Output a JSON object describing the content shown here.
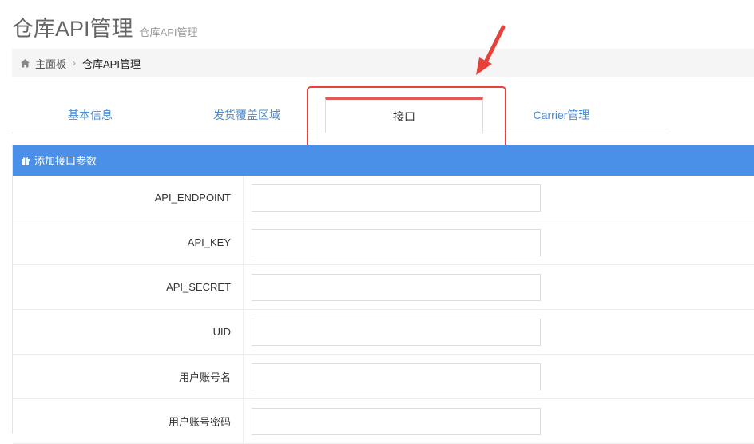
{
  "header": {
    "title": "仓库API管理",
    "subtitle": "仓库API管理"
  },
  "breadcrumb": {
    "home_icon": "home-icon",
    "items": [
      "主面板",
      "仓库API管理"
    ]
  },
  "tabs": [
    {
      "label": "基本信息",
      "active": false
    },
    {
      "label": "发货覆盖区域",
      "active": false
    },
    {
      "label": "接口",
      "active": true
    },
    {
      "label": "Carrier管理",
      "active": false
    }
  ],
  "panel": {
    "header_icon": "gift-icon",
    "header_title": "添加接口参数",
    "header_color": "#4a90e8",
    "fields": [
      {
        "label": "API_ENDPOINT",
        "value": ""
      },
      {
        "label": "API_KEY",
        "value": ""
      },
      {
        "label": "API_SECRET",
        "value": ""
      },
      {
        "label": "UID",
        "value": ""
      },
      {
        "label": "用户账号名",
        "value": ""
      },
      {
        "label": "用户账号密码",
        "value": ""
      }
    ]
  },
  "annotation": {
    "color": "#e8413a"
  }
}
